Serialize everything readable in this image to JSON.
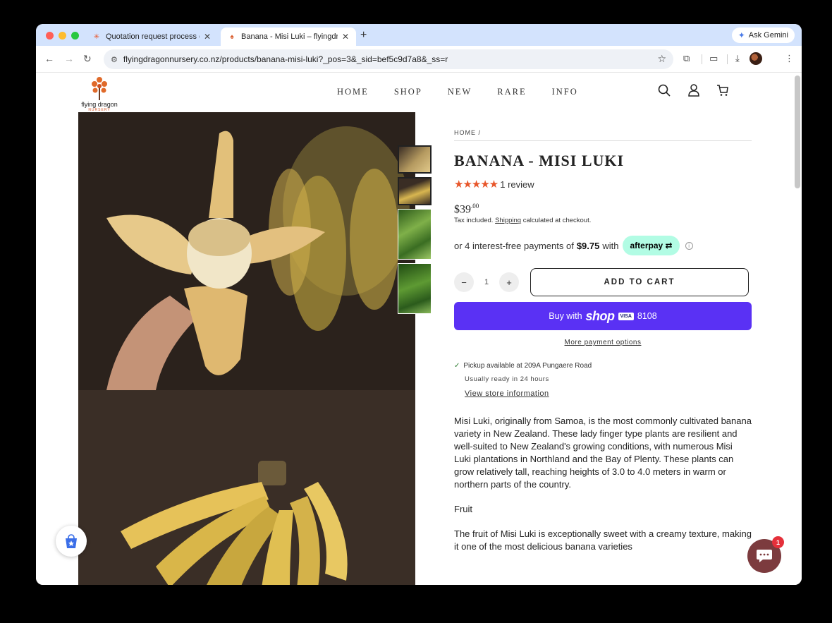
{
  "browser": {
    "tabs": [
      {
        "title": "Quotation request process ou",
        "active": false
      },
      {
        "title": "Banana - Misi Luki – flyingdra",
        "active": true
      }
    ],
    "new_tab": "+",
    "gemini_label": "Ask Gemini",
    "url": "flyingdragonnursery.co.nz/products/banana-misi-luki?_pos=3&_sid=bef5c9d7a8&_ss=r"
  },
  "site": {
    "logo_text": "flying dragon",
    "logo_sub": "NURSERY",
    "nav": [
      "HOME",
      "SHOP",
      "NEW",
      "RARE",
      "INFO"
    ]
  },
  "product": {
    "breadcrumb": "HOME /",
    "title": "BANANA - MISI LUKI",
    "stars": "★★★★★",
    "rating_value": 5,
    "review_count": "1 review",
    "price_main": "$39",
    "price_cents": ".00",
    "tax_prefix": "Tax included.",
    "tax_link": "Shipping",
    "tax_suffix": "calculated at checkout.",
    "afterpay_prefix": "or 4 interest-free payments of",
    "afterpay_amount": "$9.75",
    "afterpay_with": "with",
    "afterpay_badge": "afterpay",
    "qty_minus": "−",
    "qty_value": "1",
    "qty_plus": "+",
    "add_to_cart": "ADD TO CART",
    "buy_with": "Buy with",
    "shop_logo": "shop",
    "card_brand": "VISA",
    "card_last4": "8108",
    "more_payment": "More payment options",
    "pickup_prefix": "Pickup available at",
    "pickup_location": "209A Pungaere Road",
    "pickup_ready": "Usually ready in 24 hours",
    "store_info": "View store information",
    "description": [
      "Misi Luki, originally from Samoa, is the most commonly cultivated banana variety in New Zealand. These lady finger type plants are resilient and well-suited to New Zealand's growing conditions, with numerous Misi Luki plantations in Northland and the Bay of Plenty. These plants can grow relatively tall, reaching heights of 3.0 to 4.0 meters in warm or northern parts of the country.",
      "Fruit",
      "The fruit of Misi Luki is exceptionally sweet with a creamy texture, making it one of the most delicious banana varieties"
    ]
  },
  "chat": {
    "unread": "1"
  },
  "colors": {
    "accent": "#5a31f4",
    "star": "#e8562a",
    "afterpay": "#b2fce4",
    "chat": "#7c3b3e"
  }
}
